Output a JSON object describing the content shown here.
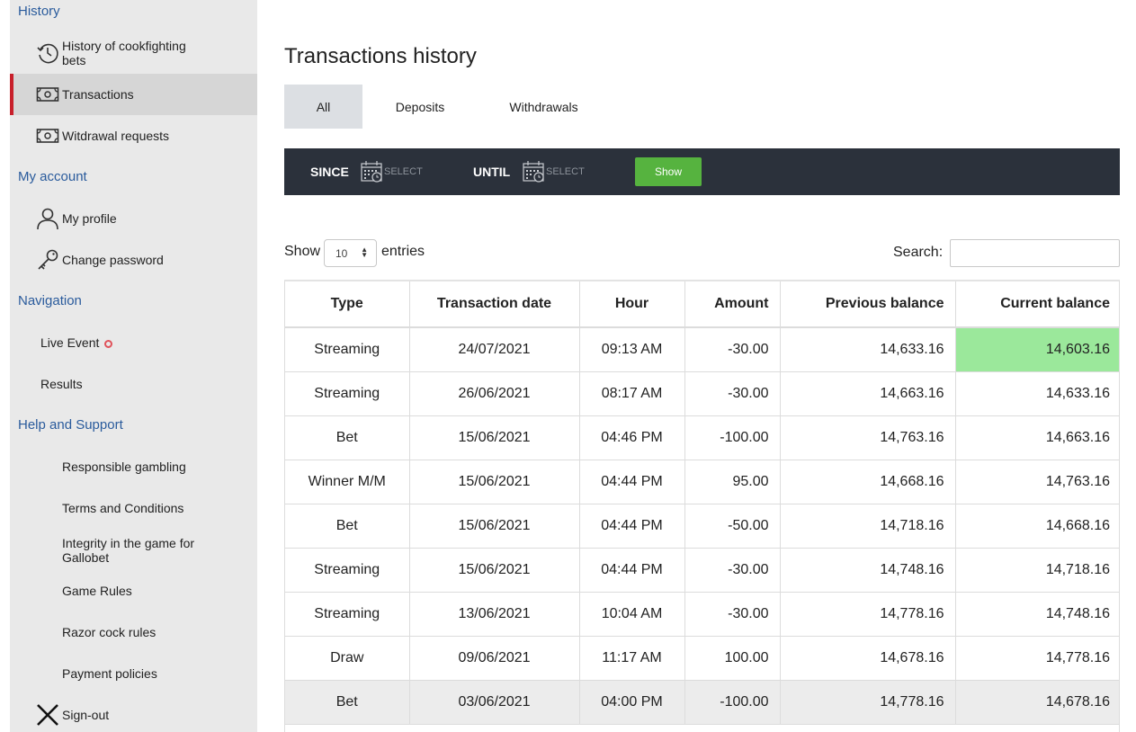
{
  "sidebar": {
    "sections": {
      "history": "History",
      "account": "My account",
      "navigation": "Navigation",
      "help": "Help and Support"
    },
    "items": {
      "cockfighting_bets": "History of cookfighting bets",
      "transactions": "Transactions",
      "withdrawal_requests": "Witdrawal requests",
      "profile": "My profile",
      "change_password": "Change password",
      "live_event": "Live Event",
      "results": "Results",
      "responsible": "Responsible gambling",
      "terms": "Terms and Conditions",
      "integrity": "Integrity in the game for Gallobet",
      "game_rules": "Game Rules",
      "razor": "Razor cock rules",
      "payment": "Payment policies",
      "signout": "Sign-out"
    },
    "active": "Transactions",
    "accent_color": "#c8202b",
    "link_color": "#2a5b9c"
  },
  "main": {
    "title": "Transactions history",
    "tabs": [
      "All",
      "Deposits",
      "Withdrawals"
    ],
    "active_tab": "All"
  },
  "filter": {
    "since_label": "SINCE",
    "until_label": "UNTIL",
    "since_value": "SELECT",
    "until_value": "SELECT",
    "show_label": "Show",
    "show_color": "#56b33f"
  },
  "table_controls": {
    "show_label": "Show",
    "entries_value": "10",
    "entries_label": "entries",
    "search_label": "Search:",
    "search_value": ""
  },
  "table": {
    "columns": [
      "Type",
      "Transaction date",
      "Hour",
      "Amount",
      "Previous balance",
      "Current balance"
    ],
    "rows": [
      [
        "Streaming",
        "24/07/2021",
        "09:13 AM",
        "-30.00",
        "14,633.16",
        "14,603.16"
      ],
      [
        "Streaming",
        "26/06/2021",
        "08:17 AM",
        "-30.00",
        "14,663.16",
        "14,633.16"
      ],
      [
        "Bet",
        "15/06/2021",
        "04:46 PM",
        "-100.00",
        "14,763.16",
        "14,663.16"
      ],
      [
        "Winner M/M",
        "15/06/2021",
        "04:44 PM",
        "95.00",
        "14,668.16",
        "14,763.16"
      ],
      [
        "Bet",
        "15/06/2021",
        "04:44 PM",
        "-50.00",
        "14,718.16",
        "14,668.16"
      ],
      [
        "Streaming",
        "15/06/2021",
        "04:44 PM",
        "-30.00",
        "14,748.16",
        "14,718.16"
      ],
      [
        "Streaming",
        "13/06/2021",
        "10:04 AM",
        "-30.00",
        "14,778.16",
        "14,748.16"
      ],
      [
        "Draw",
        "09/06/2021",
        "11:17 AM",
        "100.00",
        "14,678.16",
        "14,778.16"
      ],
      [
        "Bet",
        "03/06/2021",
        "04:00 PM",
        "-100.00",
        "14,778.16",
        "14,678.16"
      ]
    ],
    "highlight_color": "#9be89b"
  }
}
